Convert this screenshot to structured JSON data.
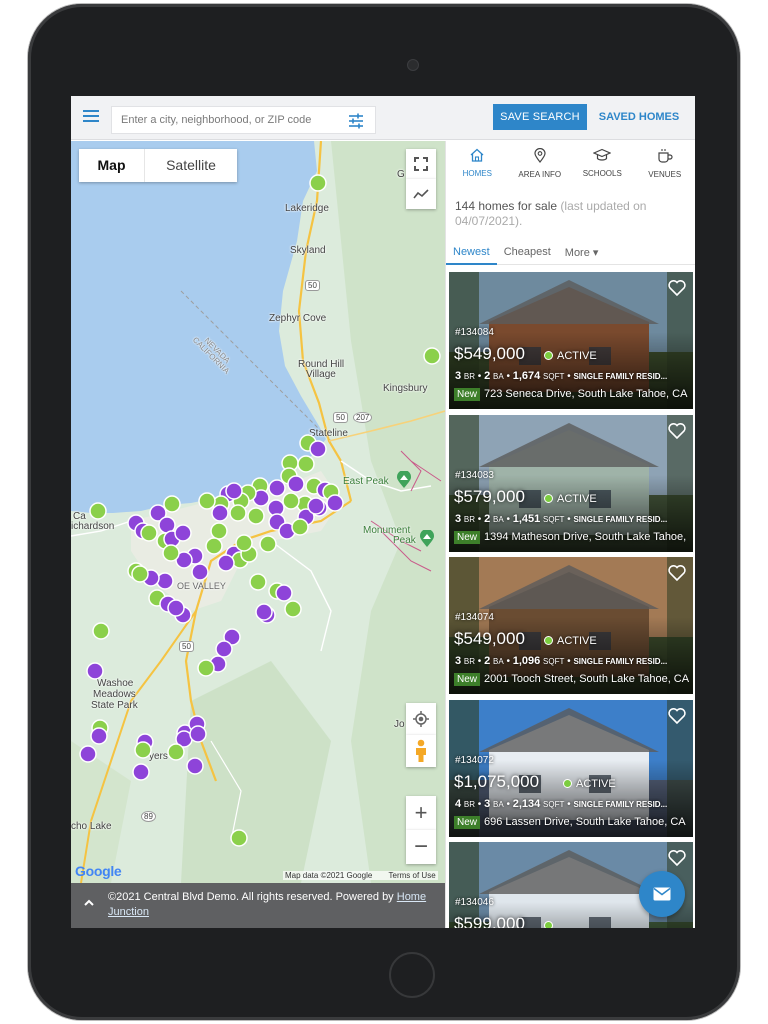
{
  "search": {
    "placeholder": "Enter a city, neighborhood, or ZIP code"
  },
  "toolbar": {
    "save_search": "SAVE SEARCH",
    "saved_homes": "SAVED HOMES"
  },
  "map": {
    "type_map": "Map",
    "type_satellite": "Satellite",
    "places": {
      "lakeridge": "Lakeridge",
      "skyland": "Skyland",
      "route50a": "50",
      "zephyr": "Zephyr Cove",
      "nevada": "NEVADA",
      "california": "CALIFORNIA",
      "roundhill1": "Round Hill",
      "roundhill2": "Village",
      "kingsbury": "Kingsbury",
      "route50b": "50",
      "route207": "207",
      "stateline": "Stateline",
      "eastpeak": "East Peak",
      "monument1": "Monument",
      "monument2": "Peak",
      "cam1": "Ca",
      "cam2": "ichardson",
      "valley1": "alley",
      "valley2": "OE VALLEY",
      "route50c": "50",
      "washoe1": "Washoe",
      "washoe2": "Meadows",
      "washoe3": "State Park",
      "myers": "yers",
      "route89": "89",
      "echolake": "cho Lake",
      "jo": "Jo",
      "g": "G"
    },
    "google": "Google",
    "attribution": "Map data ©2021 Google",
    "terms": "Terms of Use",
    "colors": {
      "active_pin": "#8bd04b",
      "other_pin": "#8e44d9"
    }
  },
  "footer": {
    "text": "©2021 Central Blvd Demo. All rights reserved. Powered by",
    "link": "Home Junction"
  },
  "tabs": [
    {
      "label": "HOMES",
      "icon": "home-icon"
    },
    {
      "label": "AREA INFO",
      "icon": "location-pin-icon"
    },
    {
      "label": "SCHOOLS",
      "icon": "graduation-cap-icon"
    },
    {
      "label": "VENUES",
      "icon": "coffee-cup-icon"
    }
  ],
  "results": {
    "count_text": "144 homes for sale",
    "updated_text": "(last updated on 04/07/2021)."
  },
  "sort": {
    "newest": "Newest",
    "cheapest": "Cheapest",
    "more": "More ▾"
  },
  "listings": [
    {
      "mls": "#134084",
      "price": "$549,000",
      "status": "ACTIVE",
      "beds": "3",
      "baths": "2",
      "sqft": "1,674",
      "type": "SINGLE FAMILY RESID...",
      "badge": "New",
      "address": "723 Seneca Drive, South Lake Tahoe, CA"
    },
    {
      "mls": "#134083",
      "price": "$579,000",
      "status": "ACTIVE",
      "beds": "3",
      "baths": "2",
      "sqft": "1,451",
      "type": "SINGLE FAMILY RESID...",
      "badge": "New",
      "address": "1394 Matheson Drive, South Lake Tahoe,"
    },
    {
      "mls": "#134074",
      "price": "$549,000",
      "status": "ACTIVE",
      "beds": "3",
      "baths": "2",
      "sqft": "1,096",
      "type": "SINGLE FAMILY RESID...",
      "badge": "New",
      "address": "2001 Tooch Street, South Lake Tahoe, CA"
    },
    {
      "mls": "#134072",
      "price": "$1,075,000",
      "status": "ACTIVE",
      "beds": "4",
      "baths": "3",
      "sqft": "2,134",
      "type": "SINGLE FAMILY RESID...",
      "badge": "New",
      "address": "696 Lassen Drive, South Lake Tahoe, CA"
    },
    {
      "mls": "#134046",
      "price": "$599,000"
    }
  ],
  "units": {
    "br": "BR",
    "ba": "BA",
    "sqft": "SQFT",
    "sep": " • "
  }
}
